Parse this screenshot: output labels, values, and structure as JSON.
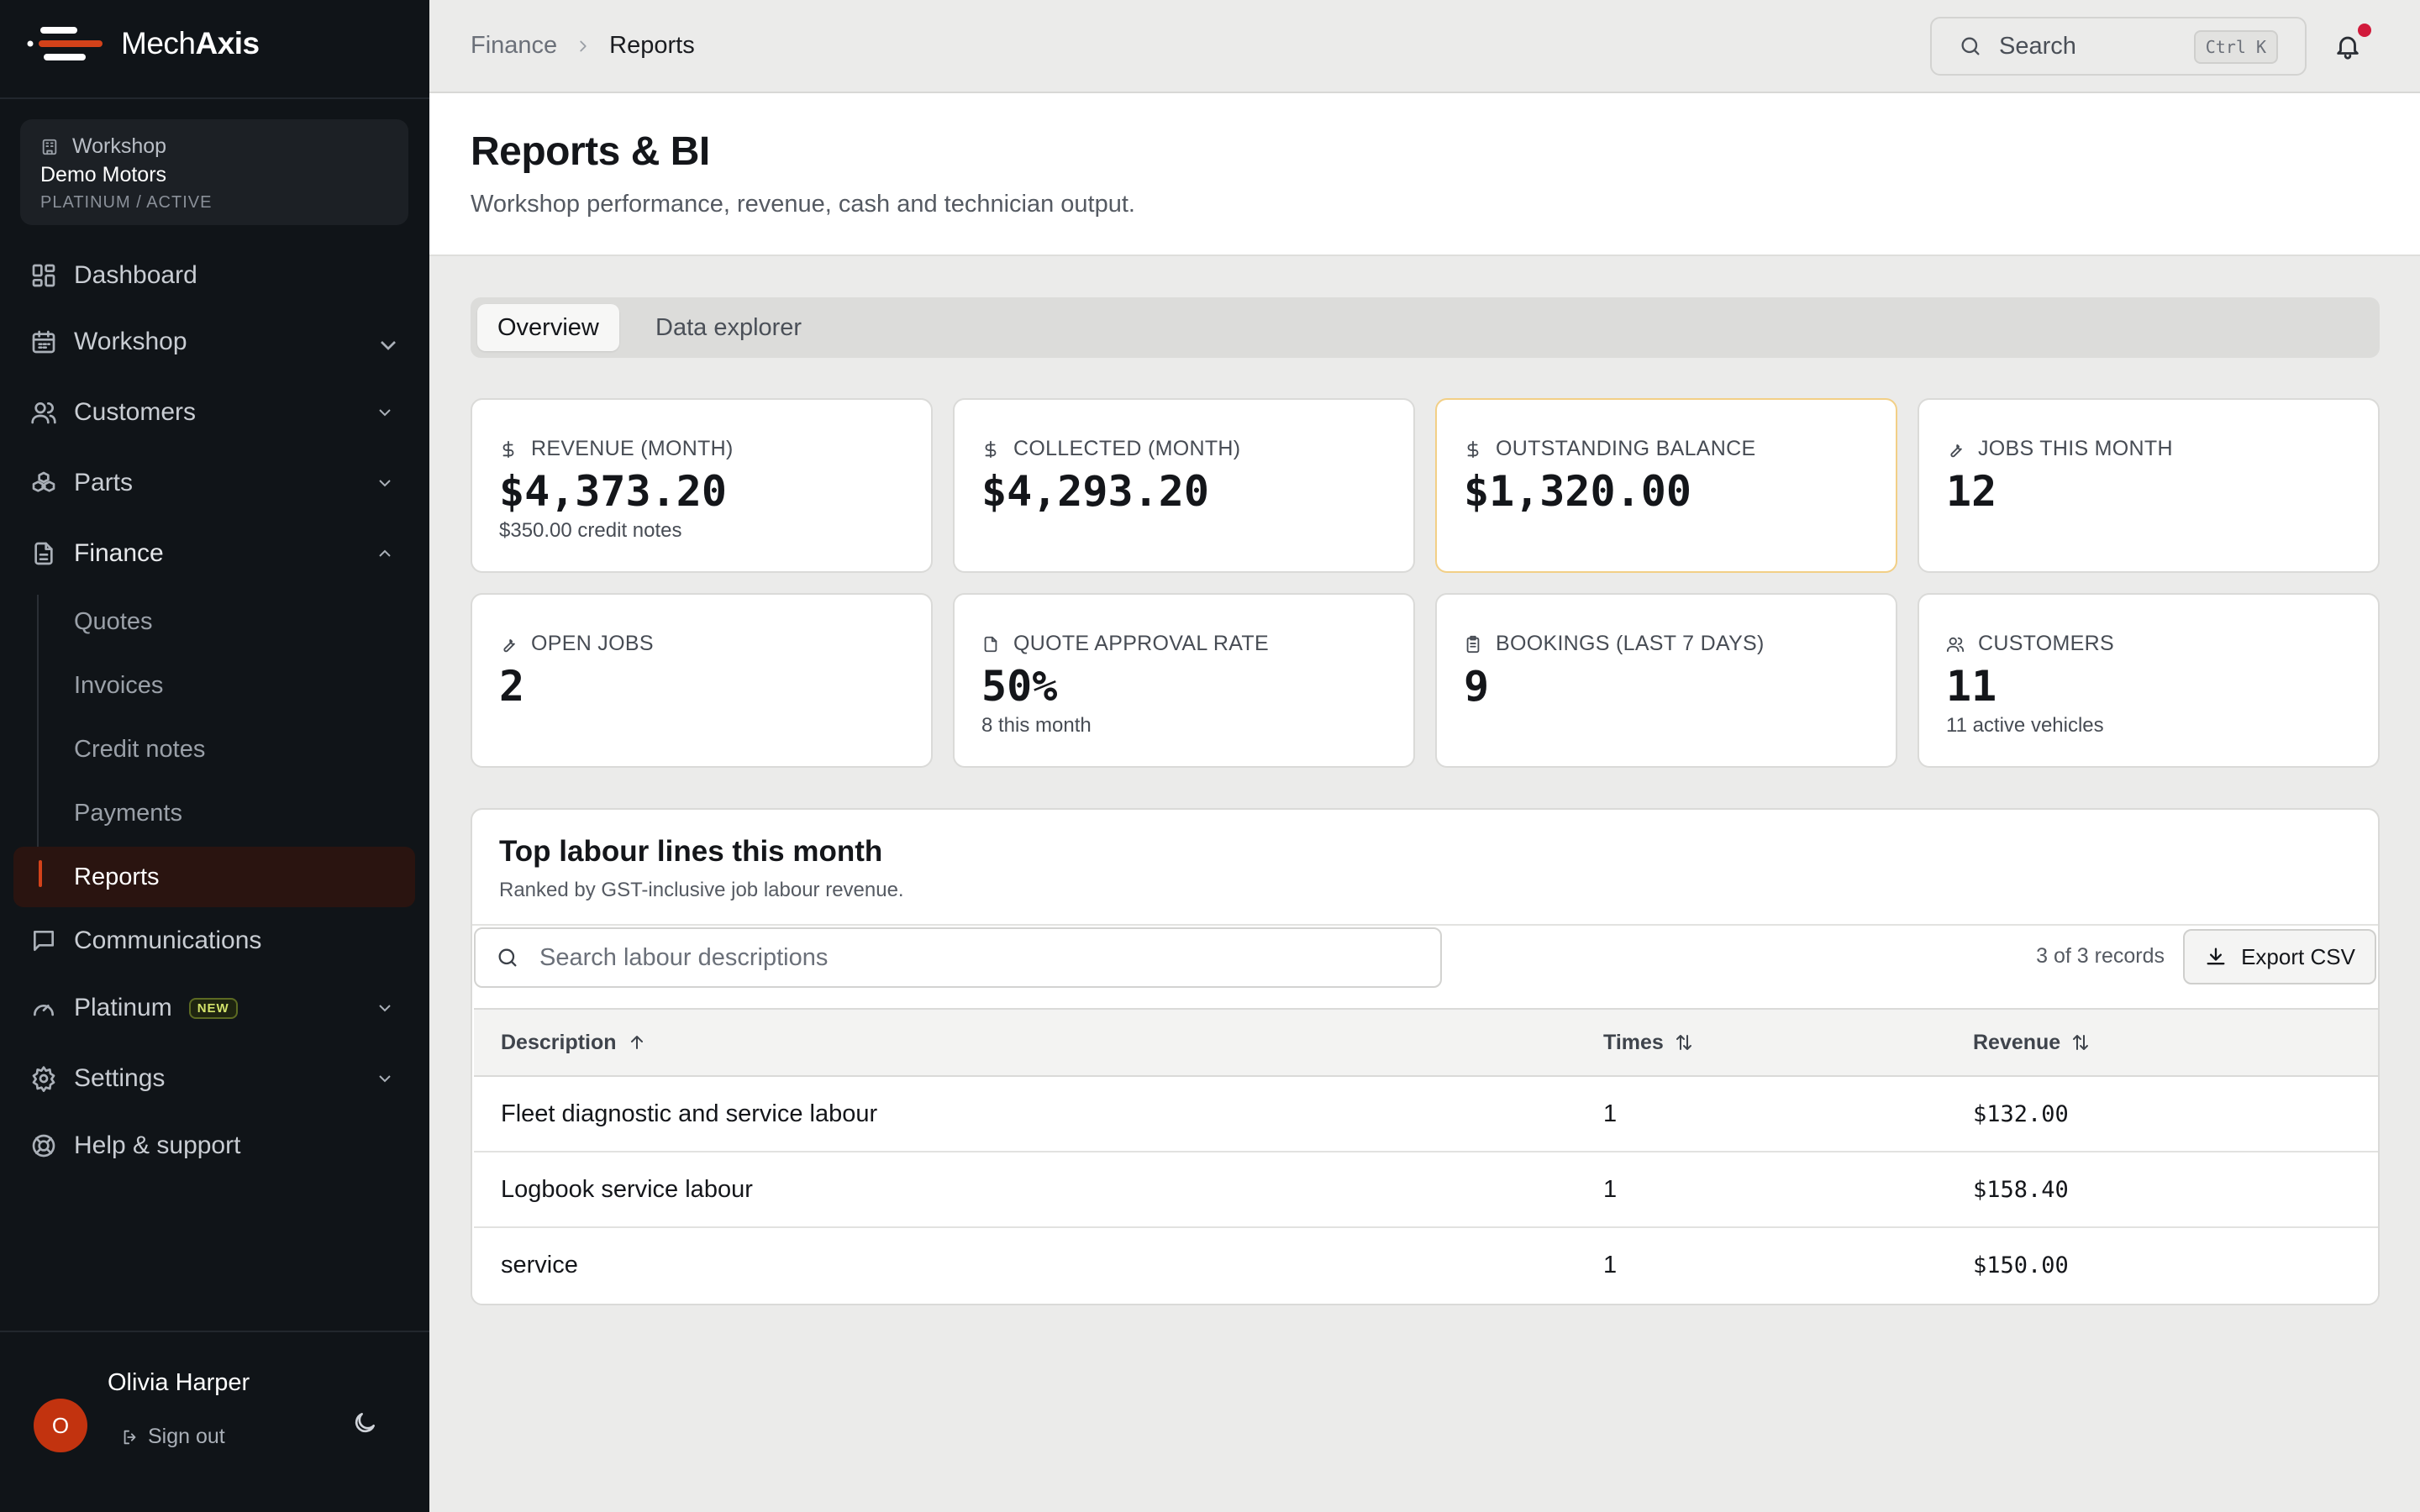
{
  "app": {
    "brand_prefix": "Mech",
    "brand_suffix": "Axis"
  },
  "workshop": {
    "label": "Workshop",
    "name": "Demo Motors",
    "tier": "PLATINUM / ACTIVE"
  },
  "nav": {
    "dashboard": "Dashboard",
    "workshop": "Workshop",
    "customers": "Customers",
    "parts": "Parts",
    "finance": "Finance",
    "finance_sub": [
      "Quotes",
      "Invoices",
      "Credit notes",
      "Payments",
      "Reports"
    ],
    "communications": "Communications",
    "platinum": "Platinum",
    "platinum_badge": "NEW",
    "settings": "Settings",
    "help": "Help & support"
  },
  "user": {
    "name": "Olivia Harper",
    "initial": "O",
    "sign_out": "Sign out"
  },
  "breadcrumb": {
    "parent": "Finance",
    "current": "Reports"
  },
  "search": {
    "placeholder": "Search",
    "shortcut": "Ctrl K"
  },
  "page": {
    "title": "Reports & BI",
    "subtitle": "Workshop performance, revenue, cash and technician output."
  },
  "tabs": [
    "Overview",
    "Data explorer"
  ],
  "kpis": [
    {
      "label": "REVENUE (MONTH)",
      "value": "$4,373.20",
      "sub": "$350.00 credit notes"
    },
    {
      "label": "COLLECTED (MONTH)",
      "value": "$4,293.20",
      "sub": ""
    },
    {
      "label": "OUTSTANDING BALANCE",
      "value": "$1,320.00",
      "sub": ""
    },
    {
      "label": "JOBS THIS MONTH",
      "value": "12",
      "sub": ""
    },
    {
      "label": "OPEN JOBS",
      "value": "2",
      "sub": ""
    },
    {
      "label": "QUOTE APPROVAL RATE",
      "value": "50%",
      "sub": "8 this month"
    },
    {
      "label": "BOOKINGS (LAST 7 DAYS)",
      "value": "9",
      "sub": ""
    },
    {
      "label": "CUSTOMERS",
      "value": "11",
      "sub": "11 active vehicles"
    }
  ],
  "labour": {
    "title": "Top labour lines this month",
    "subtitle": "Ranked by GST-inclusive job labour revenue.",
    "search_placeholder": "Search labour descriptions",
    "records": "3 of 3 records",
    "export": "Export CSV",
    "columns": [
      "Description",
      "Times",
      "Revenue"
    ],
    "rows": [
      {
        "description": "Fleet diagnostic and service labour",
        "times": "1",
        "revenue": "$132.00"
      },
      {
        "description": "Logbook service labour",
        "times": "1",
        "revenue": "$158.40"
      },
      {
        "description": "service",
        "times": "1",
        "revenue": "$150.00"
      }
    ]
  },
  "colors": {
    "accent": "#d3421a",
    "sidebar_bg": "#101418",
    "warn_border": "#f2cf86",
    "notification_dot": "#d11a3b"
  }
}
